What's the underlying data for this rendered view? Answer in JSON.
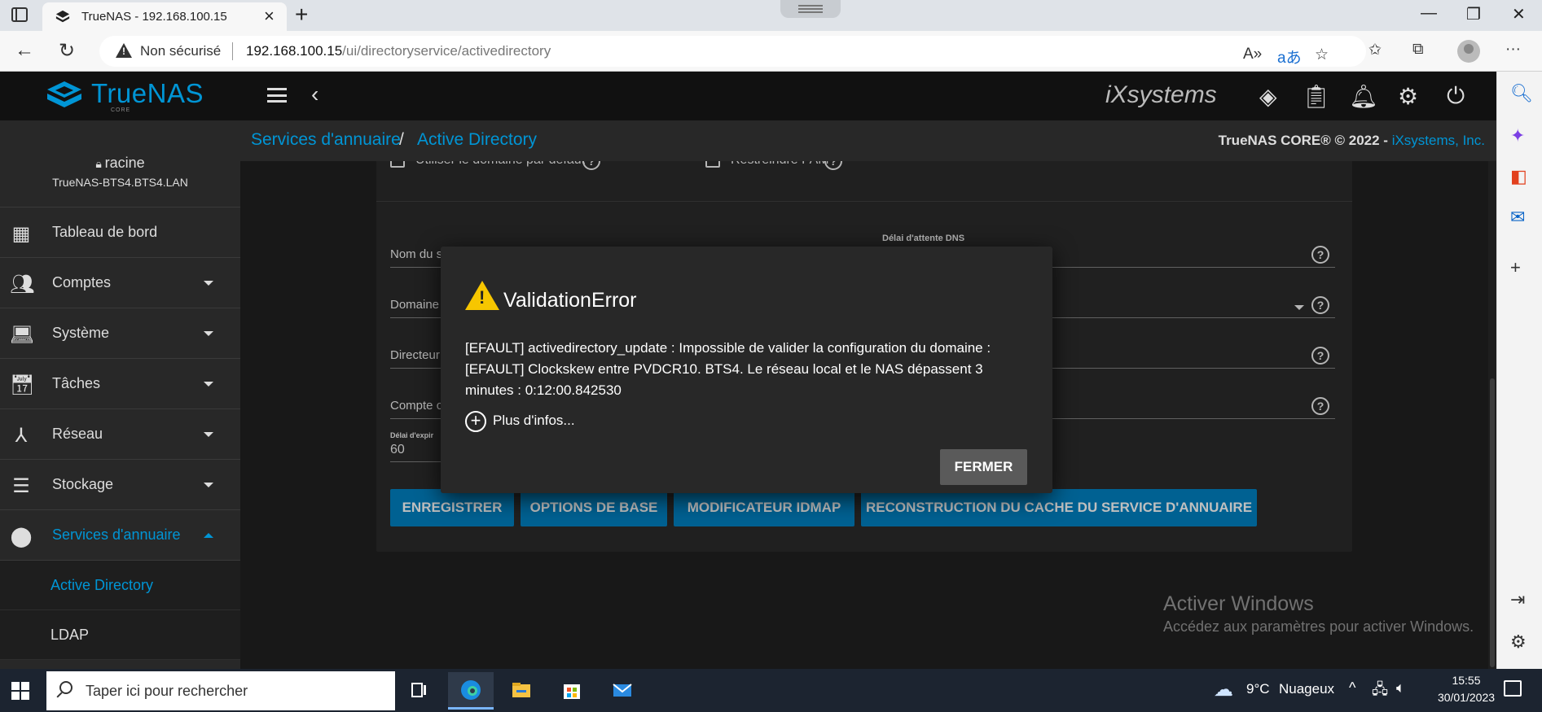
{
  "browser": {
    "tab_title": "TrueNAS - 192.168.100.15",
    "security_label": "Non sécurisé",
    "url_host": "192.168.100.15",
    "url_path": "/ui/directoryservice/activedirectory"
  },
  "header": {
    "logo_text": "TrueNAS",
    "logo_sub": "CORE",
    "vendor_logo": "iXsystems"
  },
  "breadcrumb": {
    "items": [
      "Services d'annuaire",
      "Active Directory"
    ],
    "separator": "/",
    "copyright_prefix": "TrueNAS CORE® © 2022 - ",
    "copyright_link": "iXsystems, Inc."
  },
  "user": {
    "name": "racine",
    "host": "TrueNAS-BTS4.BTS4.LAN"
  },
  "sidebar": {
    "items": [
      {
        "label": "Tableau de bord",
        "icon": "dashboard-icon"
      },
      {
        "label": "Comptes",
        "icon": "accounts-icon"
      },
      {
        "label": "Système",
        "icon": "system-icon"
      },
      {
        "label": "Tâches",
        "icon": "tasks-icon"
      },
      {
        "label": "Réseau",
        "icon": "network-icon"
      },
      {
        "label": "Stockage",
        "icon": "storage-icon"
      },
      {
        "label": "Services d'annuaire",
        "icon": "directory-services-icon"
      }
    ],
    "sub_items": [
      "Active Directory",
      "LDAP"
    ]
  },
  "form": {
    "checkbox1": "Utiliser le domaine par défaut",
    "checkbox2": "Restreindre PAM",
    "dns_timeout_label": "Délai d'attente DNS",
    "field1_label": "Nom du s",
    "field2_label": "Domaine",
    "field3_label": "Directeur",
    "field4_label": "Compte c",
    "timeout_label": "Délai d'expir",
    "timeout_value": "60"
  },
  "buttons": {
    "save": "ENREGISTRER",
    "basic_options": "OPTIONS DE BASE",
    "idmap": "MODIFICATEUR IDMAP",
    "rebuild_cache": "RECONSTRUCTION DU CACHE DU SERVICE D'ANNUAIRE"
  },
  "dialog": {
    "title": "ValidationError",
    "message": "[EFAULT] activedirectory_update : Impossible de valider la configuration du domaine : [EFAULT] Clockskew entre PVDCR10. BTS4. Le réseau local et le NAS dépassent 3 minutes : 0:12:00.842530",
    "more_info": "Plus d'infos...",
    "close": "FERMER"
  },
  "watermark": {
    "title": "Activer Windows",
    "subtitle": "Accédez aux paramètres pour activer Windows."
  },
  "taskbar": {
    "search_placeholder": "Taper ici pour rechercher",
    "weather_temp": "9°C",
    "weather_desc": "Nuageux",
    "time": "15:55",
    "date": "30/01/2023"
  },
  "colors": {
    "accent": "#0095d5",
    "button": "#0077b3",
    "warning": "#f7c600"
  }
}
